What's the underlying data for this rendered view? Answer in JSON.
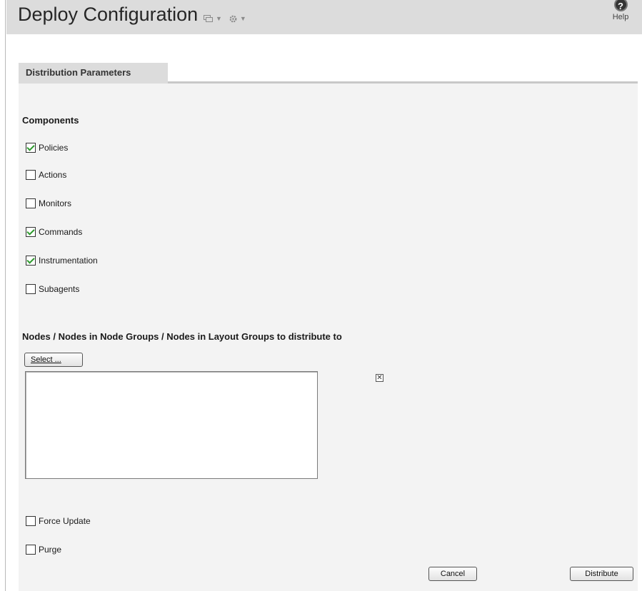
{
  "header": {
    "title": "Deploy Configuration",
    "help_label": "Help",
    "help_glyph": "?"
  },
  "tabs": [
    {
      "label": "Distribution Parameters",
      "active": true
    }
  ],
  "components": {
    "heading": "Components",
    "items": [
      {
        "label": "Policies",
        "checked": true
      },
      {
        "label": "Actions",
        "checked": false
      },
      {
        "label": "Monitors",
        "checked": false
      },
      {
        "label": "Commands",
        "checked": true
      },
      {
        "label": "Instrumentation",
        "checked": true
      },
      {
        "label": "Subagents",
        "checked": false
      }
    ]
  },
  "nodes": {
    "heading": "Nodes / Nodes in Node Groups / Nodes in Layout Groups to distribute to",
    "select_label": "Select ...",
    "clear_glyph": "✕"
  },
  "options": [
    {
      "label": "Force Update",
      "checked": false
    },
    {
      "label": "Purge",
      "checked": false
    }
  ],
  "buttons": {
    "cancel": "Cancel",
    "distribute": "Distribute"
  },
  "colors": {
    "checkmark": "#2c9a2c",
    "titlebar": "#dcdcdc",
    "content_bg": "#f3f3f3"
  }
}
